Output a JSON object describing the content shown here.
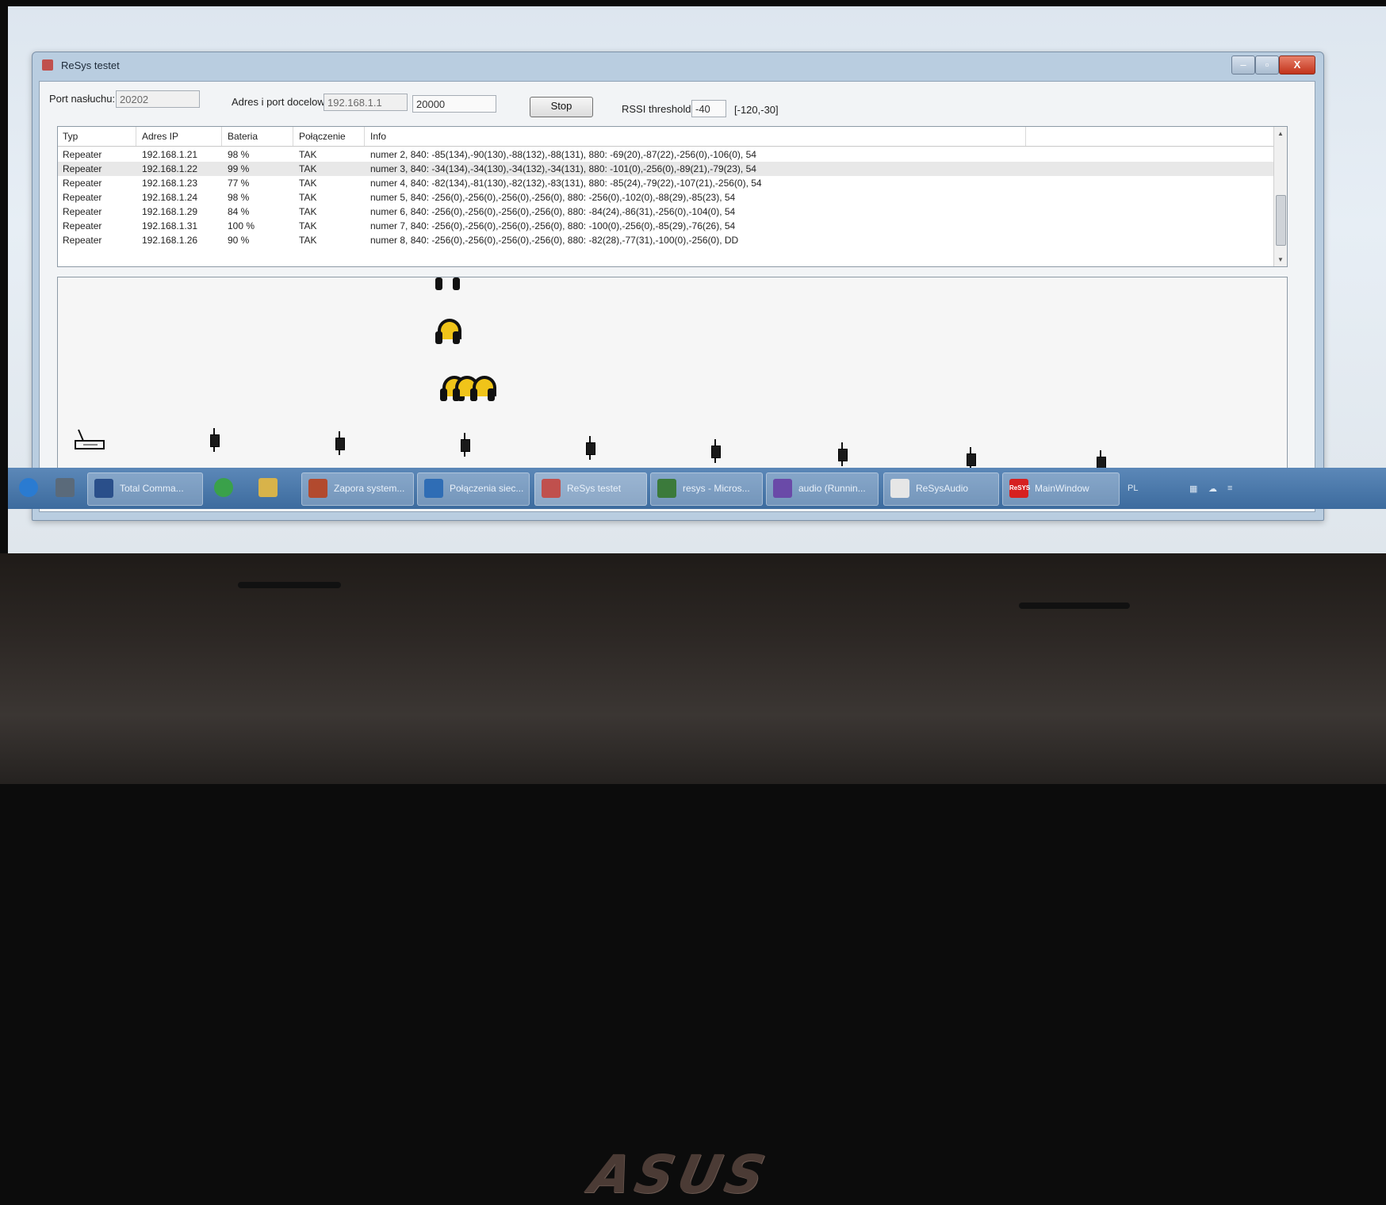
{
  "window": {
    "title": "ReSys testet",
    "controls": [
      "–",
      "▫",
      "X"
    ]
  },
  "toolbar": {
    "listen_port_label": "Port nasłuchu:",
    "listen_port_value": "20202",
    "target_label": "Adres i port docelowy",
    "target_ip": "192.168.1.1",
    "target_port": "20000",
    "stop_label": "Stop",
    "rssi_label": "RSSI threshold",
    "rssi_value": "-40",
    "rssi_range": "[-120,-30]"
  },
  "grid": {
    "columns": [
      "Typ",
      "Adres IP",
      "Bateria",
      "Połączenie",
      "Info"
    ],
    "rows": [
      {
        "typ": "Repeater",
        "ip": "192.168.1.21",
        "bat": "98 %",
        "conn": "TAK",
        "info": "numer 2, 840: -85(134),-90(130),-88(132),-88(131), 880: -69(20),-87(22),-256(0),-106(0), 54"
      },
      {
        "typ": "Repeater",
        "ip": "192.168.1.22",
        "bat": "99 %",
        "conn": "TAK",
        "info": "numer 3, 840: -34(134),-34(130),-34(132),-34(131), 880: -101(0),-256(0),-89(21),-79(23), 54"
      },
      {
        "typ": "Repeater",
        "ip": "192.168.1.23",
        "bat": "77 %",
        "conn": "TAK",
        "info": "numer 4, 840: -82(134),-81(130),-82(132),-83(131), 880: -85(24),-79(22),-107(21),-256(0), 54"
      },
      {
        "typ": "Repeater",
        "ip": "192.168.1.24",
        "bat": "98 %",
        "conn": "TAK",
        "info": "numer 5, 840: -256(0),-256(0),-256(0),-256(0), 880: -256(0),-102(0),-88(29),-85(23), 54"
      },
      {
        "typ": "Repeater",
        "ip": "192.168.1.29",
        "bat": "84 %",
        "conn": "TAK",
        "info": "numer 6, 840: -256(0),-256(0),-256(0),-256(0), 880: -84(24),-86(31),-256(0),-104(0), 54"
      },
      {
        "typ": "Repeater",
        "ip": "192.168.1.31",
        "bat": "100 %",
        "conn": "TAK",
        "info": "numer 7, 840: -256(0),-256(0),-256(0),-256(0), 880: -100(0),-256(0),-85(29),-76(26), 54"
      },
      {
        "typ": "Repeater",
        "ip": "192.168.1.26",
        "bat": "90 %",
        "conn": "TAK",
        "info": "numer 8, 840: -256(0),-256(0),-256(0),-256(0), 880: -82(28),-77(31),-100(0),-256(0), DD"
      }
    ]
  },
  "canvas": {
    "headphone_color": "#f0c419",
    "repeater_count": 8
  },
  "taskbar": {
    "items": [
      {
        "label": "Total Comma...",
        "icon": "floppy-icon",
        "color": "#2a4f8a"
      },
      {
        "label": "",
        "icon": "chrome-icon",
        "color": "#3aa14a"
      },
      {
        "label": "",
        "icon": "explorer-icon",
        "color": "#d8b34a"
      },
      {
        "label": "Zapora system...",
        "icon": "firewall-icon",
        "color": "#b24a2e"
      },
      {
        "label": "Połączenia siec...",
        "icon": "network-icon",
        "color": "#2f6db5"
      },
      {
        "label": "ReSys testet",
        "icon": "resys-icon",
        "color": "#c0504d"
      },
      {
        "label": "resys - Micros...",
        "icon": "csharp-icon",
        "color": "#3b7a3b"
      },
      {
        "label": "audio (Runnin...",
        "icon": "vs-icon",
        "color": "#6a4aa8"
      },
      {
        "label": "ReSysAudio",
        "icon": "document-icon",
        "color": "#e6e6e6"
      },
      {
        "label": "MainWindow",
        "icon": "resys-red-icon",
        "color": "#d62020",
        "icon_text": "ReSYS"
      }
    ],
    "lang": "PL"
  },
  "device": {
    "brand": "ASUS"
  }
}
